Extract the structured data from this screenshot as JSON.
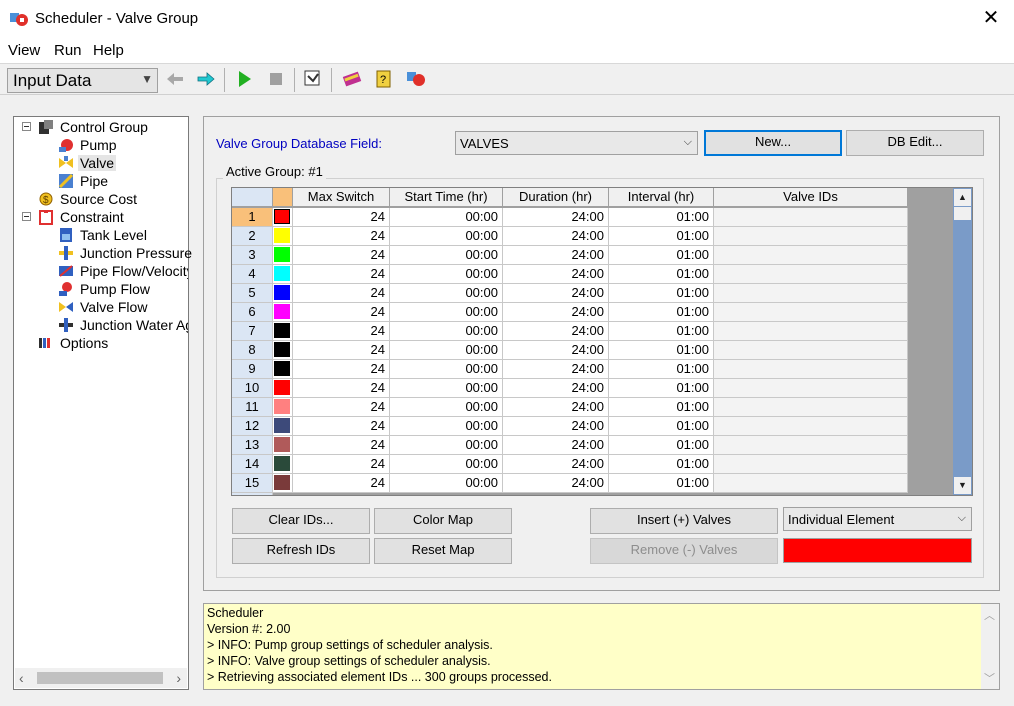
{
  "window": {
    "title": "Scheduler - Valve Group",
    "close": "✕"
  },
  "menu": [
    "View",
    "Run",
    "Help"
  ],
  "toolbar": {
    "view_select": "Input Data"
  },
  "tree": [
    {
      "label": "Control Group",
      "icon": "control-group-icon"
    },
    {
      "label": "Pump",
      "icon": "pump-icon"
    },
    {
      "label": "Valve",
      "icon": "valve-icon",
      "selected": true
    },
    {
      "label": "Pipe",
      "icon": "pipe-icon"
    },
    {
      "label": "Source Cost",
      "icon": "source-cost-icon"
    },
    {
      "label": "Constraint",
      "icon": "constraint-icon"
    },
    {
      "label": "Tank Level",
      "icon": "tank-level-icon"
    },
    {
      "label": "Junction Pressure",
      "icon": "junction-pressure-icon"
    },
    {
      "label": "Pipe Flow/Velocity",
      "icon": "pipe-flow-icon"
    },
    {
      "label": "Pump Flow",
      "icon": "pump-flow-icon"
    },
    {
      "label": "Valve Flow",
      "icon": "valve-flow-icon"
    },
    {
      "label": "Junction Water Age",
      "icon": "junction-water-age-icon"
    },
    {
      "label": "Options",
      "icon": "options-icon"
    }
  ],
  "main": {
    "db_field_label": "Valve Group Database Field:",
    "db_field_value": "VALVES",
    "new_button": "New...",
    "db_edit_button": "DB Edit...",
    "active_group": "Active Group: #1"
  },
  "grid": {
    "headers": [
      "Max Switch",
      "Start Time (hr)",
      "Duration (hr)",
      "Interval (hr)",
      "Valve IDs"
    ],
    "rows": [
      {
        "n": "1",
        "color": "#ff0000",
        "max": "24",
        "start": "00:00",
        "dur": "24:00",
        "int": "01:00"
      },
      {
        "n": "2",
        "color": "#ffff00",
        "max": "24",
        "start": "00:00",
        "dur": "24:00",
        "int": "01:00"
      },
      {
        "n": "3",
        "color": "#00ff00",
        "max": "24",
        "start": "00:00",
        "dur": "24:00",
        "int": "01:00"
      },
      {
        "n": "4",
        "color": "#00ffff",
        "max": "24",
        "start": "00:00",
        "dur": "24:00",
        "int": "01:00"
      },
      {
        "n": "5",
        "color": "#0000ff",
        "max": "24",
        "start": "00:00",
        "dur": "24:00",
        "int": "01:00"
      },
      {
        "n": "6",
        "color": "#ff00ff",
        "max": "24",
        "start": "00:00",
        "dur": "24:00",
        "int": "01:00"
      },
      {
        "n": "7",
        "color": "#000000",
        "max": "24",
        "start": "00:00",
        "dur": "24:00",
        "int": "01:00"
      },
      {
        "n": "8",
        "color": "#000000",
        "max": "24",
        "start": "00:00",
        "dur": "24:00",
        "int": "01:00"
      },
      {
        "n": "9",
        "color": "#000000",
        "max": "24",
        "start": "00:00",
        "dur": "24:00",
        "int": "01:00"
      },
      {
        "n": "10",
        "color": "#ff0000",
        "max": "24",
        "start": "00:00",
        "dur": "24:00",
        "int": "01:00"
      },
      {
        "n": "11",
        "color": "#ff8080",
        "max": "24",
        "start": "00:00",
        "dur": "24:00",
        "int": "01:00"
      },
      {
        "n": "12",
        "color": "#3d4a7a",
        "max": "24",
        "start": "00:00",
        "dur": "24:00",
        "int": "01:00"
      },
      {
        "n": "13",
        "color": "#b05a5a",
        "max": "24",
        "start": "00:00",
        "dur": "24:00",
        "int": "01:00"
      },
      {
        "n": "14",
        "color": "#2a4a3a",
        "max": "24",
        "start": "00:00",
        "dur": "24:00",
        "int": "01:00"
      },
      {
        "n": "15",
        "color": "#7a3a3a",
        "max": "24",
        "start": "00:00",
        "dur": "24:00",
        "int": "01:00"
      }
    ]
  },
  "buttons": {
    "clear_ids": "Clear IDs...",
    "color_map": "Color Map",
    "insert_valves": "Insert (+) Valves",
    "refresh_ids": "Refresh IDs",
    "reset_map": "Reset Map",
    "remove_valves": "Remove (-) Valves"
  },
  "element_select": "Individual Element",
  "selected_color": "#ff0000",
  "log": [
    "Scheduler",
    "Version #: 2.00",
    "> INFO: Pump group settings of scheduler analysis.",
    "> INFO: Valve group settings of scheduler analysis.",
    "> Retrieving associated element IDs ... 300 groups processed."
  ]
}
